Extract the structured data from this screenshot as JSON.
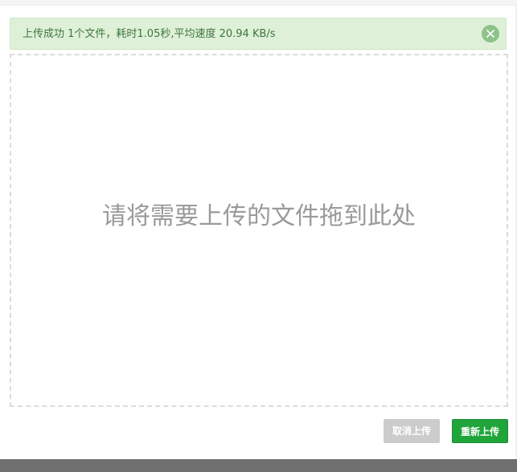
{
  "alert": {
    "message": "上传成功 1个文件，耗时1.05秒,平均速度 20.94 KB/s",
    "close_icon": "close-circle-icon"
  },
  "dropzone": {
    "prompt": "请将需要上传的文件拖到此处"
  },
  "buttons": {
    "cancel_label": "取消上传",
    "reupload_label": "重新上传"
  },
  "colors": {
    "alert_bg": "#dff0d8",
    "alert_text": "#3c763d",
    "primary": "#20a53a",
    "disabled": "#cccccc"
  }
}
